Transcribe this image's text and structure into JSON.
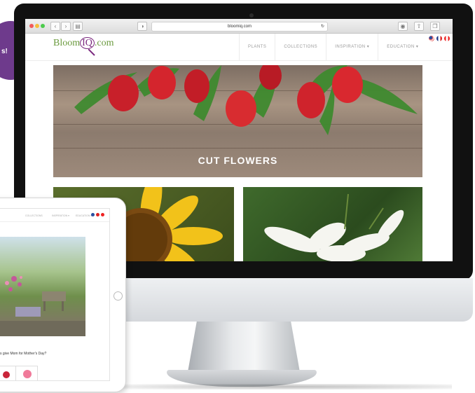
{
  "browser": {
    "url": "bloomiq.com",
    "traffic_lights": [
      "#f25b5b",
      "#f5be3b",
      "#4ccb4c"
    ]
  },
  "site": {
    "logo_prefix": "Bloom",
    "logo_iq": "IQ",
    "logo_suffix": ".com",
    "nav": [
      "PLANTS",
      "COLLECTIONS",
      "INSPIRATION ▾",
      "EDUCATION ▾"
    ],
    "flags": [
      "us-flag-icon",
      "uk-flag-icon",
      "canada-flag-icon"
    ],
    "hero_title": "CUT FLOWERS"
  },
  "ipad": {
    "nav": [
      "COLLECTIONS",
      "INSPIRATION ▾",
      "EDUCATION ▾"
    ],
    "question": "s give Mom for Mother's Day?"
  },
  "badge": {
    "text": "s!",
    "color": "#6e3a8c"
  },
  "colors": {
    "brand_green": "#6a9a3d",
    "brand_purple": "#7b2a7f"
  }
}
